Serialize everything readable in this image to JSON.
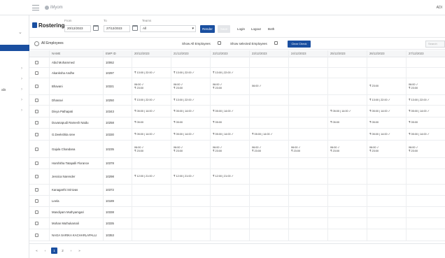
{
  "topbar": {
    "logo_text": "iMyom",
    "right_text": "ADI"
  },
  "sidebar": {
    "partial_label": "als"
  },
  "filters": {
    "title": "Rostering",
    "from_label": "From",
    "from_value": "20/12/2023",
    "to_label": "To",
    "to_value": "27/12/2023",
    "teams_label": "Teams",
    "teams_value": "All",
    "render_label": "Render",
    "save_label": "Save",
    "login_label": "Login",
    "logout_label": "Logout",
    "both_label": "Both"
  },
  "toolbar": {
    "all_employees": "All Employees",
    "show_all": "Show All Employees",
    "show_selected": "Show selected Employees",
    "clear_label": "Clear Check",
    "search_placeholder": "Search"
  },
  "table": {
    "headers": [
      "NAME",
      "EMP ID",
      "20/12/2023",
      "21/12/2023",
      "22/12/2023",
      "23/12/2023",
      "24/12/2023",
      "25/12/2023",
      "26/12/2023",
      "27/12/2023"
    ],
    "rows": [
      {
        "name": "Abid Mohammed",
        "emp": "10062",
        "cells": [
          "",
          "",
          "",
          "",
          "",
          "",
          "",
          ""
        ]
      },
      {
        "name": "Akanksha Andhe",
        "emp": "10297",
        "cells": [
          "₹ 13:00 | 22:00 ✓",
          "₹ 13:00 | 22:00 ✓",
          "₹ 13:00 | 22:00 ✓",
          "",
          "",
          "",
          "",
          ""
        ]
      },
      {
        "name": "Bhavani",
        "emp": "10321",
        "cells": [
          "06:00 ✓\n₹ 23:00",
          "06:00 ✓\n₹ 23:00",
          "06:00 ✓\n₹ 23:00",
          "06:00 ✓",
          "",
          "",
          "₹ 23:00",
          "06:00 ✓\n₹ 23:00"
        ]
      },
      {
        "name": "Dhanavi",
        "emp": "10250",
        "cells": [
          "₹ 13:00 | 22:00 ✓",
          "₹ 13:00 | 22:00 ✓",
          "",
          "",
          "",
          "",
          "₹ 13:00 | 22:00 ✓",
          "₹ 13:00 | 22:00 ✓"
        ]
      },
      {
        "name": "Divya Pathapati",
        "emp": "10343",
        "cells": [
          "₹ 05:00 | 14:00 ✓",
          "₹ 05:00 | 14:00 ✓",
          "₹ 05:00 | 14:00 ✓",
          "",
          "",
          "₹ 05:00 | 14:00 ✓",
          "₹ 05:00 | 14:00 ✓",
          "₹ 05:00 | 14:00 ✓"
        ]
      },
      {
        "name": "Duvanapudi Ramesh Naidu",
        "emp": "10258",
        "cells": [
          "₹ 05:00",
          "₹ 05:00",
          "₹ 05:00",
          "",
          "",
          "₹ 05:00",
          "₹ 05:00",
          "₹ 05:00"
        ]
      },
      {
        "name": "G.Deekshita sree",
        "emp": "10330",
        "cells": [
          "₹ 05:00 | 14:00 ✓",
          "₹ 05:00 | 14:00 ✓",
          "₹ 05:00 | 14:00 ✓",
          "₹ 05:00 | 14:00 ✓",
          "",
          "",
          "₹ 05:00 | 14:00 ✓",
          "₹ 05:00 | 14:00 ✓"
        ]
      },
      {
        "name": "Gajula Chandana",
        "emp": "10235",
        "cells": [
          "06:00 ✓\n₹ 23:00",
          "06:00 ✓\n₹ 23:00",
          "06:00 ✓\n₹ 23:00",
          "06:00 ✓\n₹ 23:00",
          "06:00 ✓\n₹ 23:00",
          "06:00 ✓\n₹ 23:00",
          "06:00 ✓\n₹ 23:00",
          "06:00 ✓\n₹ 23:00"
        ]
      },
      {
        "name": "Harshitha Tatapalli Florance",
        "emp": "10378",
        "cells": [
          "",
          "",
          "",
          "",
          "",
          "",
          "",
          ""
        ]
      },
      {
        "name": "Jessica Narender",
        "emp": "10298",
        "cells": [
          "₹ 12:00 | 21:00 ✓",
          "₹ 12:00 | 21:00 ✓",
          "₹ 12:00 | 21:00 ✓",
          "",
          "",
          "",
          "",
          ""
        ]
      },
      {
        "name": "Kanagarthi Srinivas",
        "emp": "10372",
        "cells": [
          "",
          "",
          "",
          "",
          "",
          "",
          "",
          ""
        ]
      },
      {
        "name": "Leela",
        "emp": "10189",
        "cells": [
          "",
          "",
          "",
          "",
          "",
          "",
          "",
          ""
        ]
      },
      {
        "name": "Mandiyam Muthyamgari",
        "emp": "10338",
        "cells": [
          "",
          "",
          "",
          "",
          "",
          "",
          "",
          ""
        ]
      },
      {
        "name": "Mohan Muthukamali",
        "emp": "10335",
        "cells": [
          "",
          "",
          "",
          "",
          "",
          "",
          "",
          ""
        ]
      },
      {
        "name": "NAGA SARIKA KACHARLAPALLI",
        "emp": "10353",
        "cells": [
          "",
          "",
          "",
          "",
          "",
          "",
          "",
          ""
        ]
      }
    ]
  },
  "pager": {
    "first": "«",
    "prev": "‹",
    "page1": "1",
    "page2": "2",
    "next": "›",
    "last": "»"
  }
}
